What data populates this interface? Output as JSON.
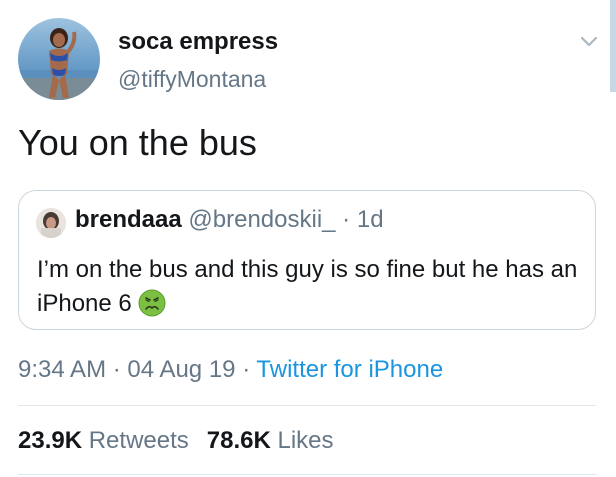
{
  "author": {
    "display_name": "soca empress",
    "handle": "@tiffyMontana"
  },
  "tweet": {
    "text": "You on the bus"
  },
  "quoted": {
    "display_name": "brendaaa",
    "handle": "@brendoskii_",
    "separator": "·",
    "time": "1d",
    "text": "I’m on the bus and this guy is so fine but he has an iPhone 6",
    "emoji_icon": "nauseated-face-icon"
  },
  "meta": {
    "time": "9:34 AM",
    "sep1": "·",
    "date": "04 Aug 19",
    "sep2": "·",
    "source": "Twitter for iPhone"
  },
  "stats": {
    "retweets_count": "23.9K",
    "retweets_label": "Retweets",
    "likes_count": "78.6K",
    "likes_label": "Likes"
  },
  "colors": {
    "text": "#14171a",
    "secondary": "#657786",
    "link": "#1b95e0",
    "border": "#ccd6dd"
  },
  "icons": {
    "menu": "chevron-down-icon",
    "avatar": "avatar"
  }
}
